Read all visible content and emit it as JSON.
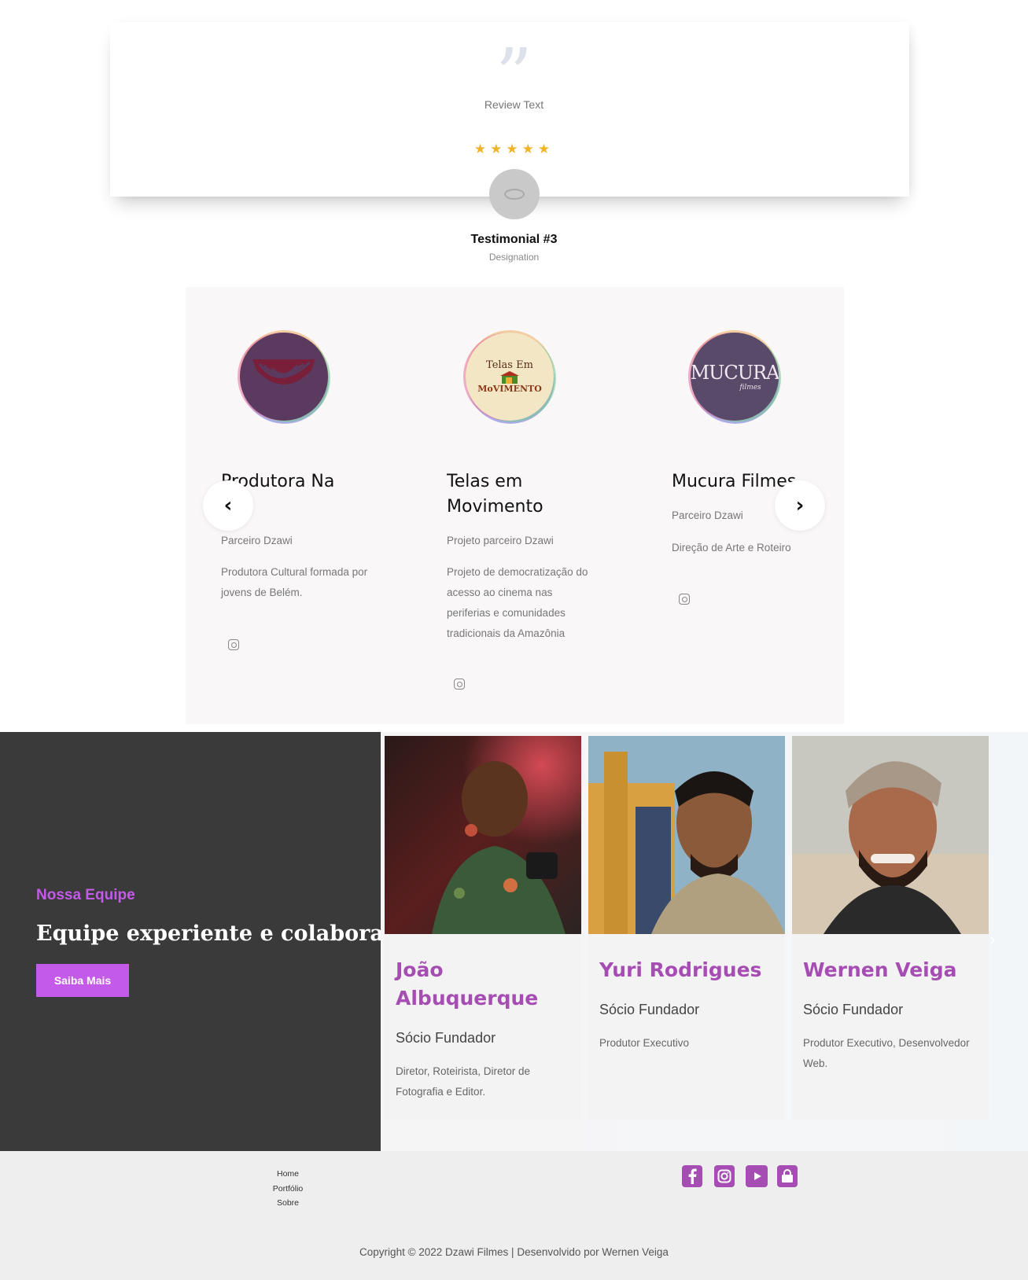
{
  "testimonial": {
    "review_text": "Review Text",
    "stars": "★★★★★",
    "rating": 5,
    "name": "Testimonial #3",
    "designation": "Designation"
  },
  "partners": [
    {
      "title": "Produtora Na Lúa",
      "subtitle": "Parceiro Dzawi",
      "description": "Produtora Cultural formada por jovens de Belém.",
      "logo_color": "#5a3a5e"
    },
    {
      "title": "Telas em Movimento",
      "subtitle": "Projeto parceiro Dzawi",
      "description": "Projeto de democratização do acesso ao cinema nas periferias e comunidades tradicionais da Amazônia",
      "logo_text_top": "Telas Em",
      "logo_text_bottom": "MoVIMENTO",
      "logo_color": "#f2e6c4"
    },
    {
      "title": "Mucura Filmes",
      "subtitle": "Parceiro Dzawi",
      "description": "Direção de Arte e Roteiro",
      "logo_text": "MUCURA",
      "logo_subtext": "filmes",
      "logo_color": "#5a4a6a"
    }
  ],
  "carousel": {
    "prev": "‹",
    "next": "›"
  },
  "team": {
    "eyebrow": "Nossa Equipe",
    "heading": "Equipe experiente e colaborativa.",
    "button": "Saiba Mais",
    "accent": "#c45ae9",
    "members": [
      {
        "name": "João Albuquerque",
        "role": "Sócio Fundador",
        "description": "Diretor, Roteirista, Diretor de Fotografia e Editor."
      },
      {
        "name": "Yuri Rodrigues",
        "role": "Sócio Fundador",
        "description": "Produtor Executivo"
      },
      {
        "name": "Wernen Veiga",
        "role": "Sócio Fundador",
        "description": "Produtor Executivo, Desenvolvedor Web."
      }
    ]
  },
  "footer": {
    "links": [
      "Home",
      "Portfólio",
      "Sobre"
    ],
    "social_icons": [
      "facebook-icon",
      "instagram-icon",
      "youtube-icon",
      "shopping-bag-icon"
    ],
    "social_color": "#a64db3",
    "copyright": "Copyright © 2022 Dzawi Filmes | Desenvolvido por Wernen Veiga"
  }
}
